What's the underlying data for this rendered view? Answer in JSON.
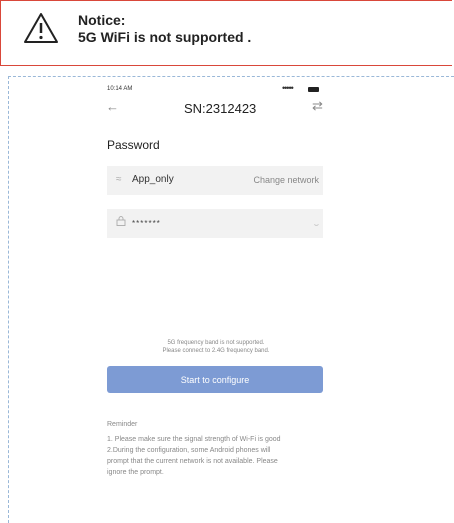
{
  "notice": {
    "title": "Notice:",
    "message": "5G WiFi is not supported ."
  },
  "phone": {
    "status_bar": {
      "time": "10:14 AM",
      "signal_dots": "•••••"
    },
    "header": {
      "back_icon": "arrow-left-icon",
      "title": "SN:2312423",
      "switch_icon": "swap-arrows-icon"
    },
    "password_section": {
      "title": "Password"
    },
    "network_field": {
      "icon": "wifi-icon",
      "name": "App_only",
      "action": "Change network"
    },
    "password_field": {
      "icon": "lock-icon",
      "value": "*******",
      "toggle_icon": "eye-closed-icon"
    },
    "band_notice": [
      "5G frequency band is not supported.",
      "Please connect to 2.4G frequency band."
    ],
    "configure_button": "Start to configure",
    "reminder": {
      "title": "Reminder",
      "lines": [
        "1. Please make sure the signal strength of Wi-Fi is good",
        "2.During the configuration, some Android phones will",
        "prompt that the current network is not available. Please",
        "ignore the prompt."
      ]
    },
    "colors": {
      "accent": "#7d9bd4",
      "notice_border": "#d9473a"
    }
  }
}
